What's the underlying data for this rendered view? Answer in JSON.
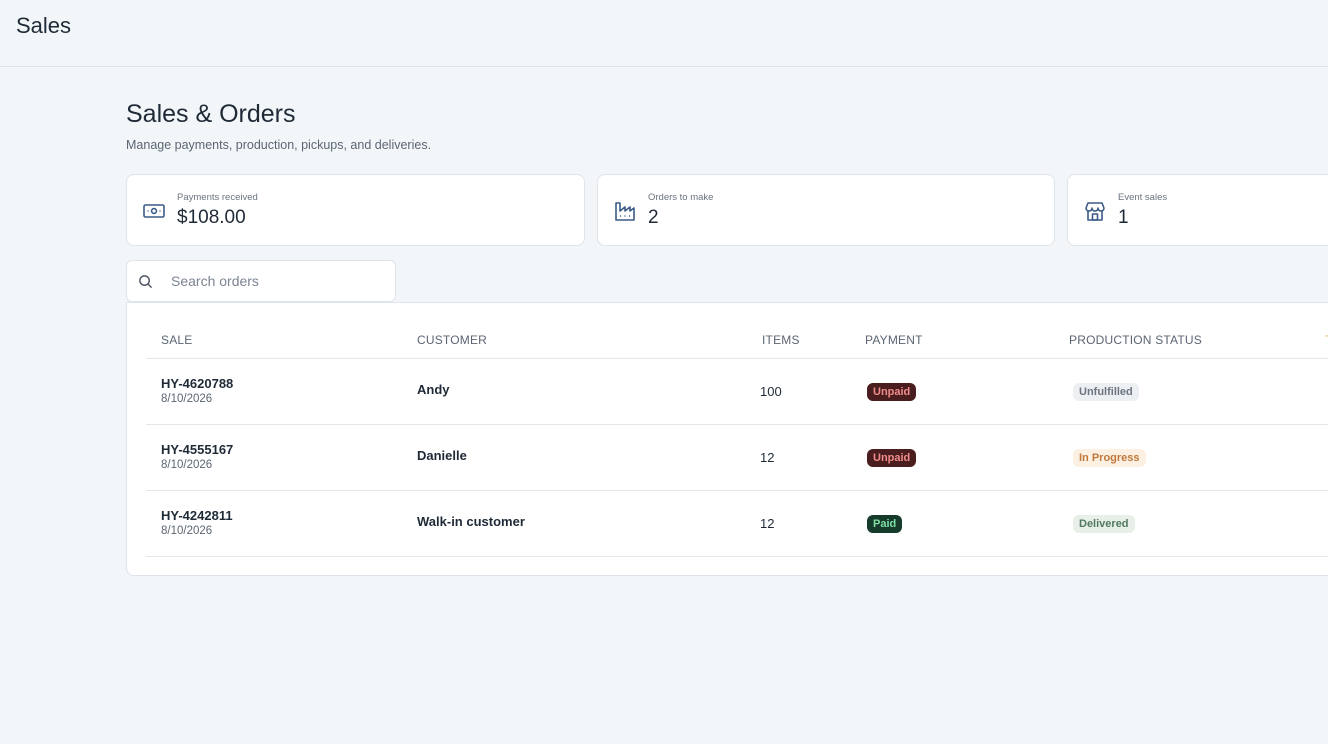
{
  "header": {
    "app_title": "Sales"
  },
  "page": {
    "title": "Sales & Orders",
    "subtitle": "Manage payments, production, pickups, and deliveries."
  },
  "stats": [
    {
      "label": "Payments received",
      "value": "$108.00",
      "icon": "cash-icon"
    },
    {
      "label": "Orders to make",
      "value": "2",
      "icon": "factory-icon"
    },
    {
      "label": "Event sales",
      "value": "1",
      "icon": "storefront-icon"
    }
  ],
  "search": {
    "placeholder": "Search orders",
    "value": ""
  },
  "table": {
    "columns": [
      "SALE",
      "CUSTOMER",
      "ITEMS",
      "PAYMENT",
      "PRODUCTION STATUS",
      "T"
    ],
    "rows": [
      {
        "sale_id": "HY-4620788",
        "date": "8/10/2026",
        "customer": "Andy",
        "items": "100",
        "payment": "Unpaid",
        "production": "Unfulfilled"
      },
      {
        "sale_id": "HY-4555167",
        "date": "8/10/2026",
        "customer": "Danielle",
        "items": "12",
        "payment": "Unpaid",
        "production": "In Progress"
      },
      {
        "sale_id": "HY-4242811",
        "date": "8/10/2026",
        "customer": "Walk-in customer",
        "items": "12",
        "payment": "Paid",
        "production": "Delivered"
      }
    ]
  },
  "colors": {
    "background": "#f3f6f9",
    "icon_blue": "#3b5b86",
    "unpaid_badge": "#4a1d1f",
    "paid_badge": "#163b2a",
    "in_progress_badge": "#fbf0e2"
  }
}
